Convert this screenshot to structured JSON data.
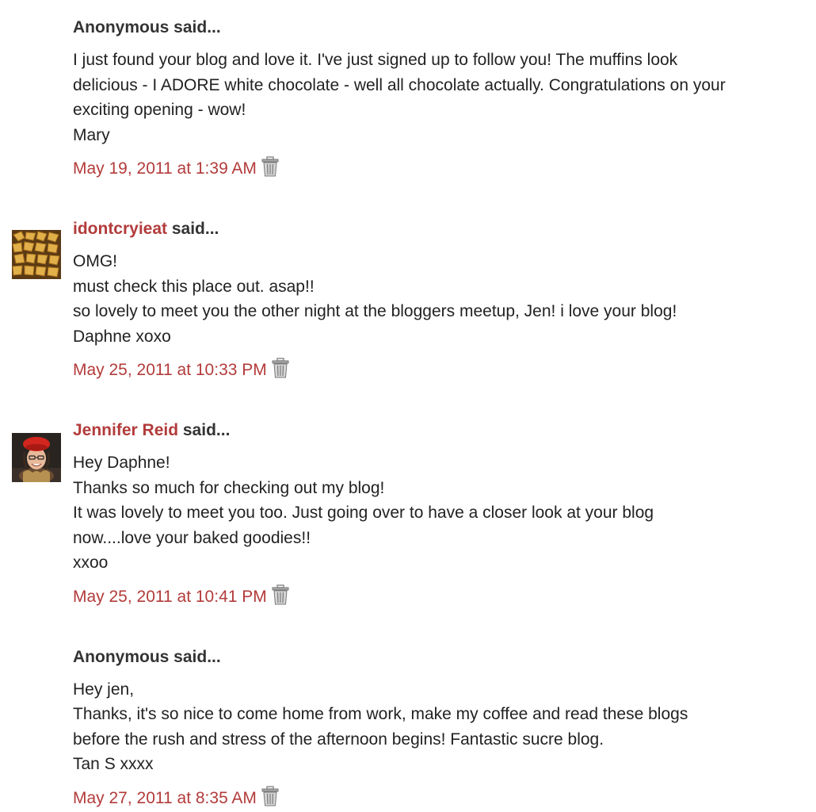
{
  "comments": [
    {
      "author": "Anonymous",
      "said": " said...",
      "lines": [
        "I just found your blog and love it. I've just signed up to follow you! The muffins look",
        "delicious - I ADORE white chocolate - well all chocolate actually. Congratulations on your",
        "exciting opening - wow!",
        "Mary"
      ],
      "timestamp": "May 19, 2011 at 1:39 AM",
      "avatar_icon": ""
    },
    {
      "author": "idontcryieat",
      "said": " said...",
      "lines": [
        "OMG!",
        "must check this place out. asap!!",
        "so lovely to meet you the other night at the bloggers meetup, Jen! i love your blog!",
        "Daphne xoxo"
      ],
      "timestamp": "May 25, 2011 at 10:33 PM",
      "avatar_icon": "cookies-avatar"
    },
    {
      "author": "Jennifer Reid",
      "said": " said...",
      "lines": [
        "Hey Daphne!",
        "Thanks so much for checking out my blog!",
        "It was lovely to meet you too. Just going over to have a closer look at your blog",
        "now....love your baked goodies!!",
        "xxoo"
      ],
      "timestamp": "May 25, 2011 at 10:41 PM",
      "avatar_icon": "portrait-avatar"
    },
    {
      "author": "Anonymous",
      "said": " said...",
      "lines": [
        "Hey jen,",
        "Thanks, it's so nice to come home from work, make my coffee and read these blogs",
        "before the rush and stress of the afternoon begins! Fantastic sucre blog.",
        "Tan S xxxx"
      ],
      "timestamp": "May 27, 2011 at 8:35 AM",
      "avatar_icon": ""
    }
  ],
  "icons": {
    "delete": "trash-icon"
  },
  "colors": {
    "link": "#b33b3b",
    "text": "#333333"
  }
}
